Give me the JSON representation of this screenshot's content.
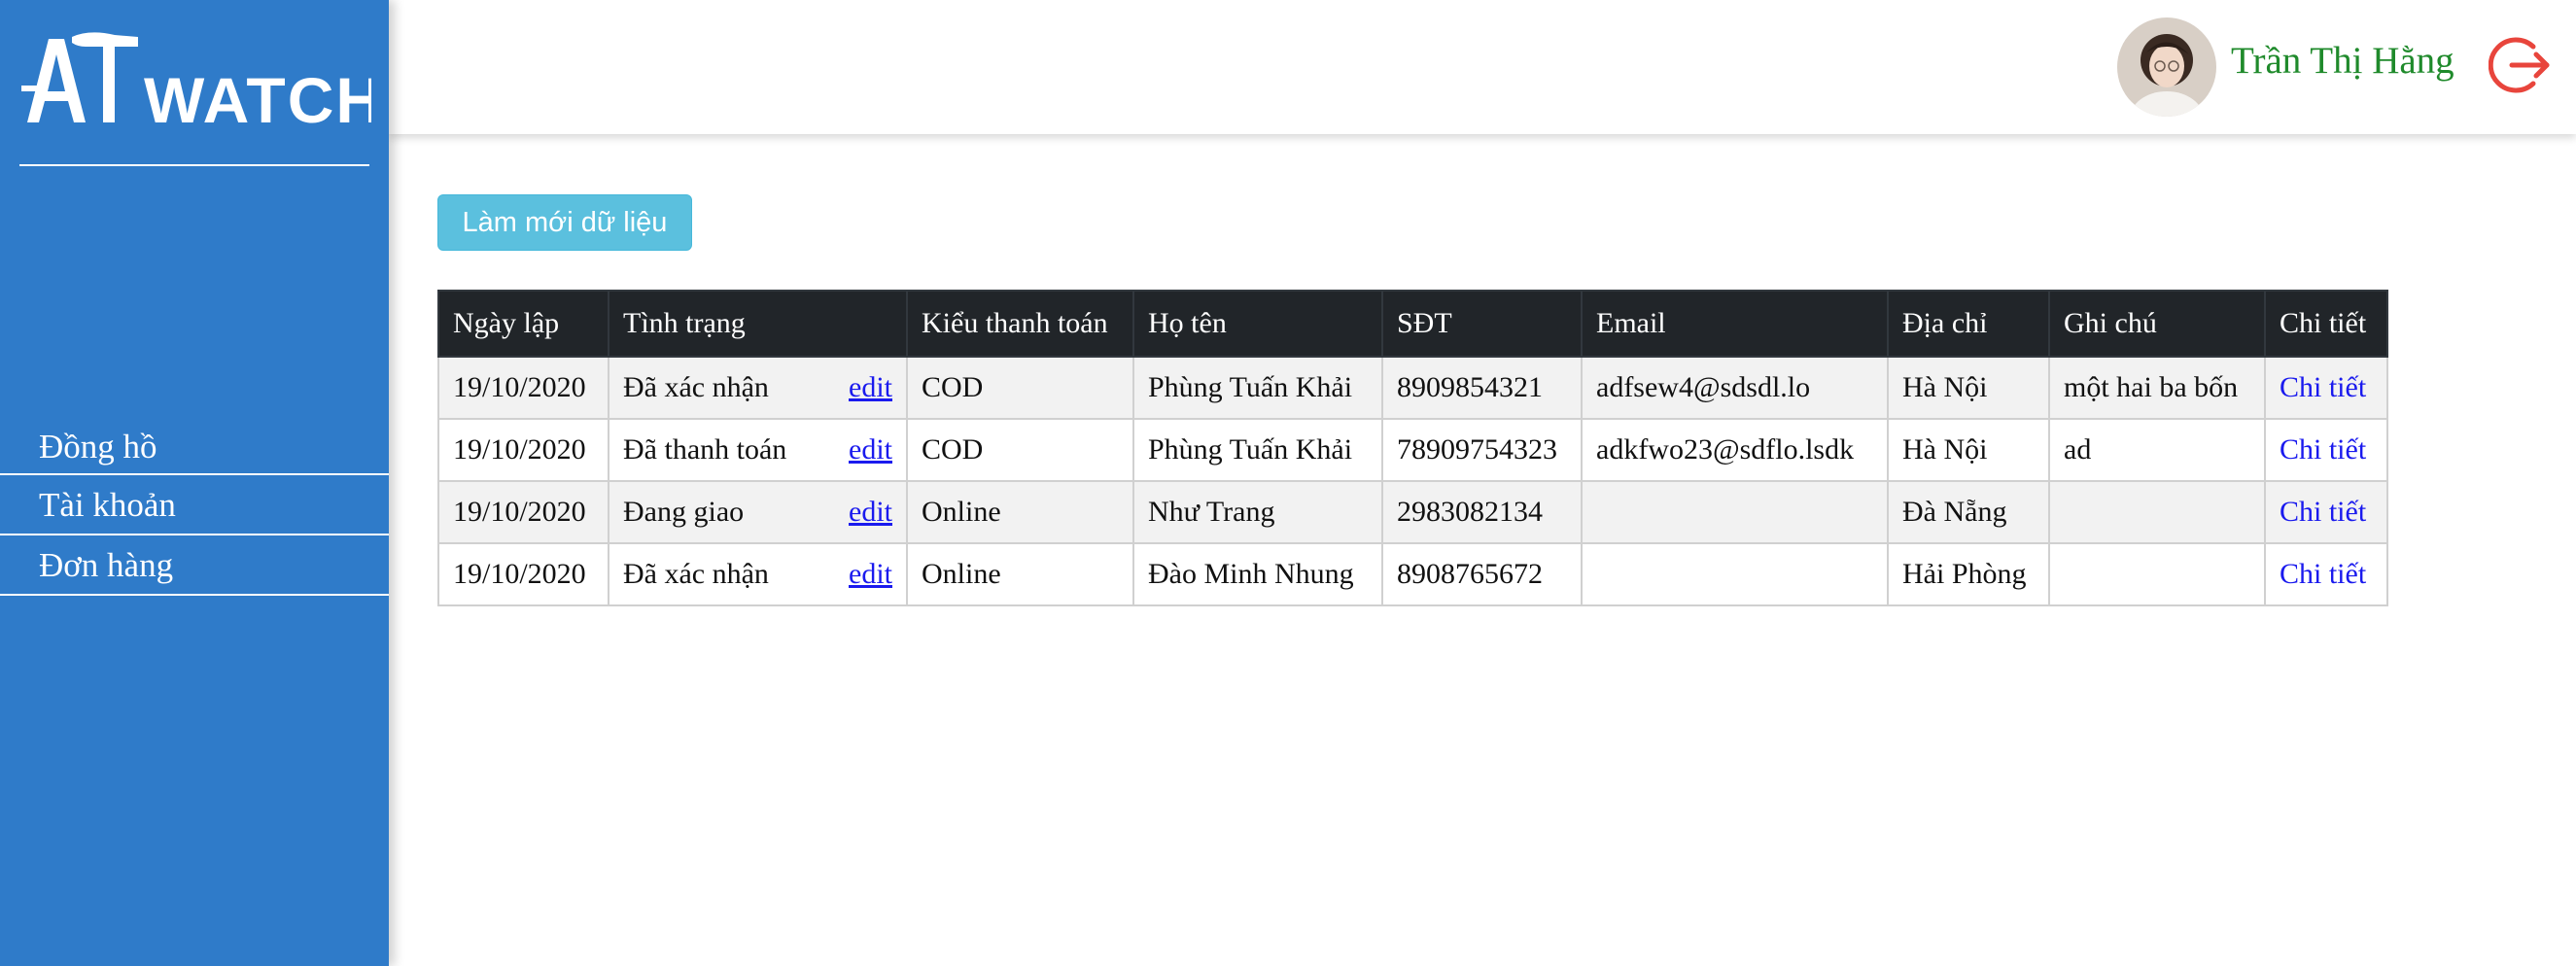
{
  "brand": {
    "logo_text": "ATWATCH"
  },
  "sidebar": {
    "items": [
      {
        "label": "Đồng hồ"
      },
      {
        "label": "Tài khoản"
      },
      {
        "label": "Đơn hàng"
      }
    ]
  },
  "header": {
    "user_name": "Trần Thị Hằng",
    "avatar_icon": "user-avatar",
    "logout_icon": "logout-icon"
  },
  "actions": {
    "refresh_label": "Làm mới dữ liệu"
  },
  "table": {
    "headers": {
      "date": "Ngày lập",
      "status": "Tình trạng",
      "payment": "Kiểu thanh toán",
      "name": "Họ tên",
      "phone": "SĐT",
      "email": "Email",
      "address": "Địa chỉ",
      "note": "Ghi chú",
      "detail": "Chi tiết"
    },
    "rows": [
      {
        "date": "19/10/2020",
        "status": "Đã xác nhận",
        "edit": "edit",
        "payment": "COD",
        "name": "Phùng Tuấn Khải",
        "phone": "8909854321",
        "email": "adfsew4@sdsdl.lo",
        "address": "Hà Nội",
        "note": "một hai ba bốn",
        "detail": "Chi tiết"
      },
      {
        "date": "19/10/2020",
        "status": "Đã thanh toán",
        "edit": "edit",
        "payment": "COD",
        "name": "Phùng Tuấn Khải",
        "phone": "78909754323",
        "email": "adkfwo23@sdflo.lsdk",
        "address": "Hà Nội",
        "note": "ad",
        "detail": "Chi tiết"
      },
      {
        "date": "19/10/2020",
        "status": "Đang giao",
        "edit": "edit",
        "payment": "Online",
        "name": "Như Trang",
        "phone": "2983082134",
        "email": "",
        "address": "Đà Nẵng",
        "note": "",
        "detail": "Chi tiết"
      },
      {
        "date": "19/10/2020",
        "status": "Đã xác nhận",
        "edit": "edit",
        "payment": "Online",
        "name": "Đào Minh Nhung",
        "phone": "8908765672",
        "email": "",
        "address": "Hải Phòng",
        "note": "",
        "detail": "Chi tiết"
      }
    ]
  },
  "colors": {
    "sidebar_bg": "#2f7bc9",
    "username": "#1f8a2b",
    "logout": "#e8453c",
    "button_bg": "#5bc0de",
    "table_header_bg": "#212529",
    "link": "#1a1aee"
  }
}
